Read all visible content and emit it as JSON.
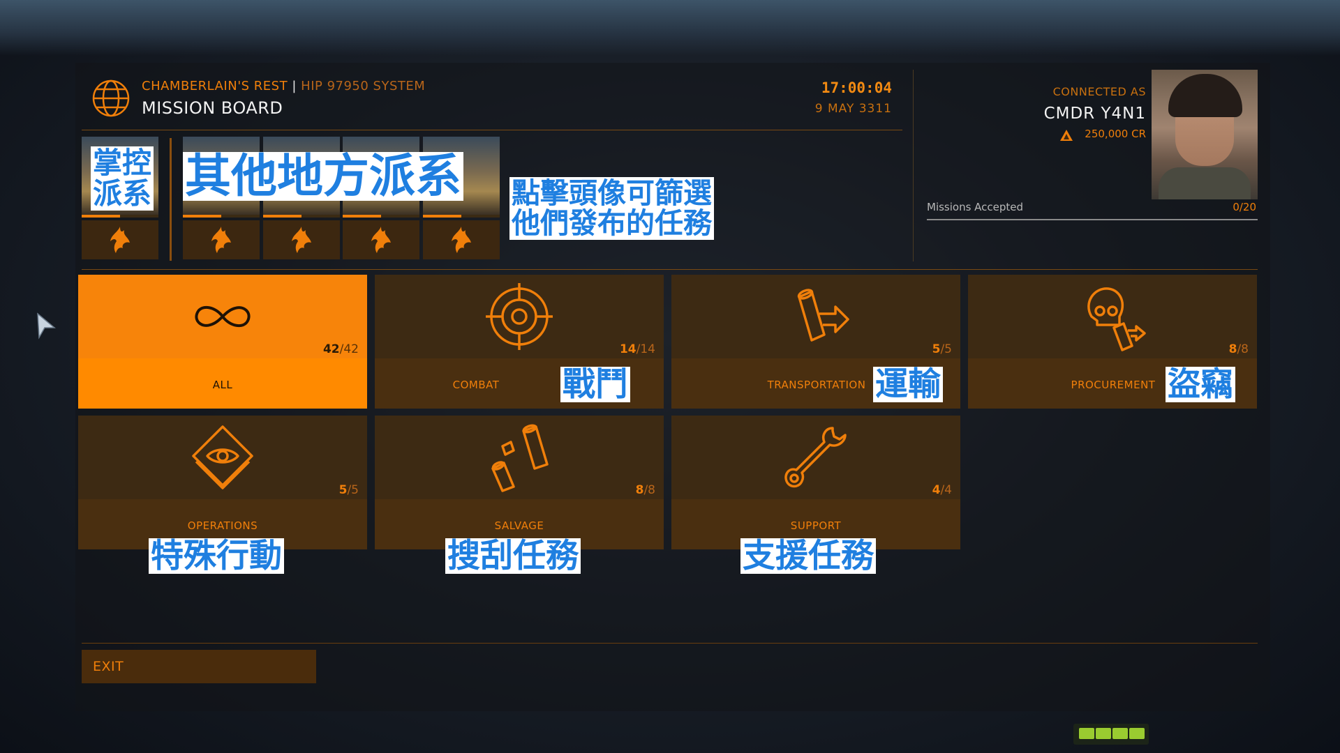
{
  "header": {
    "station": "CHAMBERLAIN'S REST",
    "divider": "|",
    "system": "HIP 97950 SYSTEM",
    "title": "MISSION BOARD",
    "time": "17:00:04",
    "date": "9 MAY 3311"
  },
  "commander": {
    "connected_label": "CONNECTED AS",
    "name": "CMDR Y4N1",
    "credits": "250,000 CR",
    "missions_label": "Missions Accepted",
    "missions_count": "0/20"
  },
  "factions": {
    "controlling": {
      "reputation": 0.5,
      "icon": "phoenix-emblem-icon"
    },
    "others": [
      {
        "reputation": 0.5,
        "icon": "phoenix-emblem-icon"
      },
      {
        "reputation": 0.5,
        "icon": "phoenix-emblem-icon"
      },
      {
        "reputation": 0.5,
        "icon": "phoenix-emblem-icon"
      },
      {
        "reputation": 0.5,
        "icon": "phoenix-emblem-icon"
      }
    ]
  },
  "annotations": {
    "controlling_line1": "掌控",
    "controlling_line2": "派系",
    "other_factions": "其他地方派系",
    "hint_line1": "點擊頭像可篩選",
    "hint_line2": "他們發布的任務",
    "combat": "戰鬥",
    "transportation": "運輸",
    "procurement": "盜竊",
    "operations": "特殊行動",
    "salvage": "搜刮任務",
    "support": "支援任務"
  },
  "categories": [
    {
      "label": "ALL",
      "count": "42",
      "total": "/42",
      "icon": "infinity-icon",
      "active": true
    },
    {
      "label": "COMBAT",
      "count": "14",
      "total": "/14",
      "icon": "crosshair-icon",
      "active": false
    },
    {
      "label": "TRANSPORTATION",
      "count": "5",
      "total": "/5",
      "icon": "cargo-arrow-icon",
      "active": false
    },
    {
      "label": "PROCUREMENT",
      "count": "8",
      "total": "/8",
      "icon": "skull-cargo-icon",
      "active": false
    },
    {
      "label": "OPERATIONS",
      "count": "5",
      "total": "/5",
      "icon": "eye-diamond-icon",
      "active": false
    },
    {
      "label": "SALVAGE",
      "count": "8",
      "total": "/8",
      "icon": "salvage-canisters-icon",
      "active": false
    },
    {
      "label": "SUPPORT",
      "count": "4",
      "total": "/4",
      "icon": "wrench-icon",
      "active": false
    }
  ],
  "footer": {
    "exit_label": "EXIT"
  },
  "colors": {
    "accent": "#f07f0a",
    "active_tile": "#ff8a00",
    "annotation_text": "#1f7fe0"
  }
}
